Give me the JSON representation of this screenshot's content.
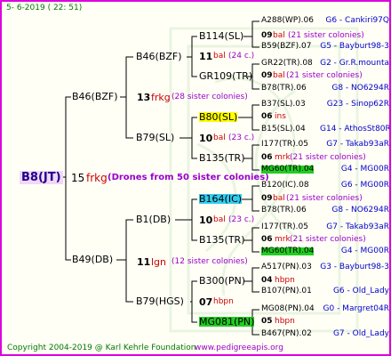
{
  "date_line": "5-  6-2019 ( 22: 51)",
  "footer": {
    "copyright": "Copyright 2004-2019 @ Karl Kehrle Foundation",
    "url": "www.pedigreeapis.org"
  },
  "colors": {
    "border": "#dd00dd",
    "highlight_yellow": "#ffff00",
    "highlight_cyan": "#33ccee",
    "highlight_green": "#22cc22",
    "root_bg": "#f0d8f8"
  },
  "root": {
    "name": "B8(JT)",
    "gen_num": "15",
    "gen_code": "frkg",
    "note": "(Drones from 50 sister colonies)"
  },
  "gen1": {
    "top": {
      "name": "B46(BZF)"
    },
    "bottom": {
      "name": "B49(DB)"
    }
  },
  "gen2": [
    {
      "name": "B46(BZF)",
      "num": "13",
      "code": "frkg",
      "note": "(28 sister colonies)"
    },
    {
      "name": "B79(SL)",
      "num": "10",
      "code": "bal",
      "note": "(23 c.)"
    },
    {
      "name": "B1(DB)",
      "num": "10",
      "code": "bal",
      "note": "(23 c.)"
    },
    {
      "name": "B79(HGS)",
      "num": "07",
      "code": "hbpn",
      "note": ""
    }
  ],
  "gen3": [
    {
      "name": "B114(SL)",
      "num": "11",
      "code": "bal",
      "note": "(24 c.)"
    },
    {
      "name": "GR109(TR)",
      "num": "09",
      "code": "bal",
      "note": "(21 sister colonies)"
    },
    {
      "name": "B80(SL)",
      "num": "06",
      "code": "ins",
      "note": ""
    },
    {
      "name": "B135(TR)",
      "num": "06",
      "code": "mrk",
      "note": "(21 sister colonies)"
    },
    {
      "name": "B164(IC)",
      "num": "09",
      "code": "bal",
      "note": "(21 sister colonies)"
    },
    {
      "name": "B135(TR)",
      "num": "06",
      "code": "mrk",
      "note": "(21 sister colonies)"
    },
    {
      "name": "B300(PN)",
      "num": "04",
      "code": "hbpn",
      "note": ""
    },
    {
      "name": "MG081(PN)",
      "num": "05",
      "code": "hbpn",
      "note": ""
    }
  ],
  "gen4": [
    {
      "name": "A288(WP).06",
      "info": "G6 - Cankiri97Q"
    },
    {
      "name": "B59(BZF).07",
      "info": "G5 - Bayburt98-3"
    },
    {
      "name": "GR22(TR).08",
      "info": "G2 - Gr.R.mounta"
    },
    {
      "name": "B78(TR).06",
      "info": "G8 - NO6294R"
    },
    {
      "name": "B37(SL).03",
      "info": "G23 - Sinop62R"
    },
    {
      "name": "B15(SL).04",
      "info": "G14 - AthosSt80R"
    },
    {
      "name": "I177(TR).05",
      "info": "G7 - Takab93aR"
    },
    {
      "name": "MG60(TR).04",
      "info": "G4 - MG00R"
    },
    {
      "name": "B120(IC).08",
      "info": "G6 - MG00R"
    },
    {
      "name": "B78(TR).06",
      "info": "G8 - NO6294R"
    },
    {
      "name": "I177(TR).05",
      "info": "G7 - Takab93aR"
    },
    {
      "name": "MG60(TR).04",
      "info": "G4 - MG00R"
    },
    {
      "name": "A517(PN).03",
      "info": "G3 - Bayburt98-3"
    },
    {
      "name": "B107(PN).01",
      "info": "G6 - Old_Lady"
    },
    {
      "name": "MG08(PN).04",
      "info": "G0 - Margret04R"
    },
    {
      "name": "B467(PN).02",
      "info": "G7 - Old_Lady"
    }
  ]
}
